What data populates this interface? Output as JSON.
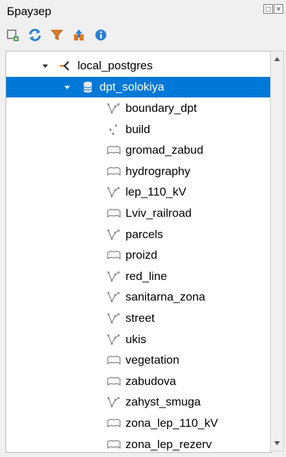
{
  "panel": {
    "title": "Браузер"
  },
  "toolbar": {
    "buttons": [
      {
        "name": "add-selected-layers-icon"
      },
      {
        "name": "refresh-icon"
      },
      {
        "name": "filter-icon"
      },
      {
        "name": "collapse-all-icon"
      },
      {
        "name": "info-icon"
      }
    ]
  },
  "tree": {
    "connection": {
      "label": "local_postgres",
      "icon": "postgres-connection-icon"
    },
    "schema": {
      "label": "dpt_solokiya",
      "icon": "database-schema-icon"
    },
    "layers": [
      {
        "label": "boundary_dpt",
        "type": "line"
      },
      {
        "label": "build",
        "type": "point"
      },
      {
        "label": "gromad_zabud",
        "type": "polygon"
      },
      {
        "label": "hydrography",
        "type": "polygon"
      },
      {
        "label": "lep_110_kV",
        "type": "line"
      },
      {
        "label": "Lviv_railroad",
        "type": "polygon"
      },
      {
        "label": "parcels",
        "type": "line"
      },
      {
        "label": "proizd",
        "type": "polygon"
      },
      {
        "label": "red_line",
        "type": "line"
      },
      {
        "label": "sanitarna_zona",
        "type": "line"
      },
      {
        "label": "street",
        "type": "line"
      },
      {
        "label": "ukis",
        "type": "line"
      },
      {
        "label": "vegetation",
        "type": "polygon"
      },
      {
        "label": "zabudova",
        "type": "polygon"
      },
      {
        "label": "zahyst_smuga",
        "type": "line"
      },
      {
        "label": "zona_lep_110_kV",
        "type": "polygon"
      },
      {
        "label": "zona_lep_rezerv",
        "type": "polygon"
      }
    ]
  },
  "colors": {
    "selection": "#0078d7",
    "accent_blue": "#2a7fd4",
    "filter_orange": "#e0781e"
  }
}
